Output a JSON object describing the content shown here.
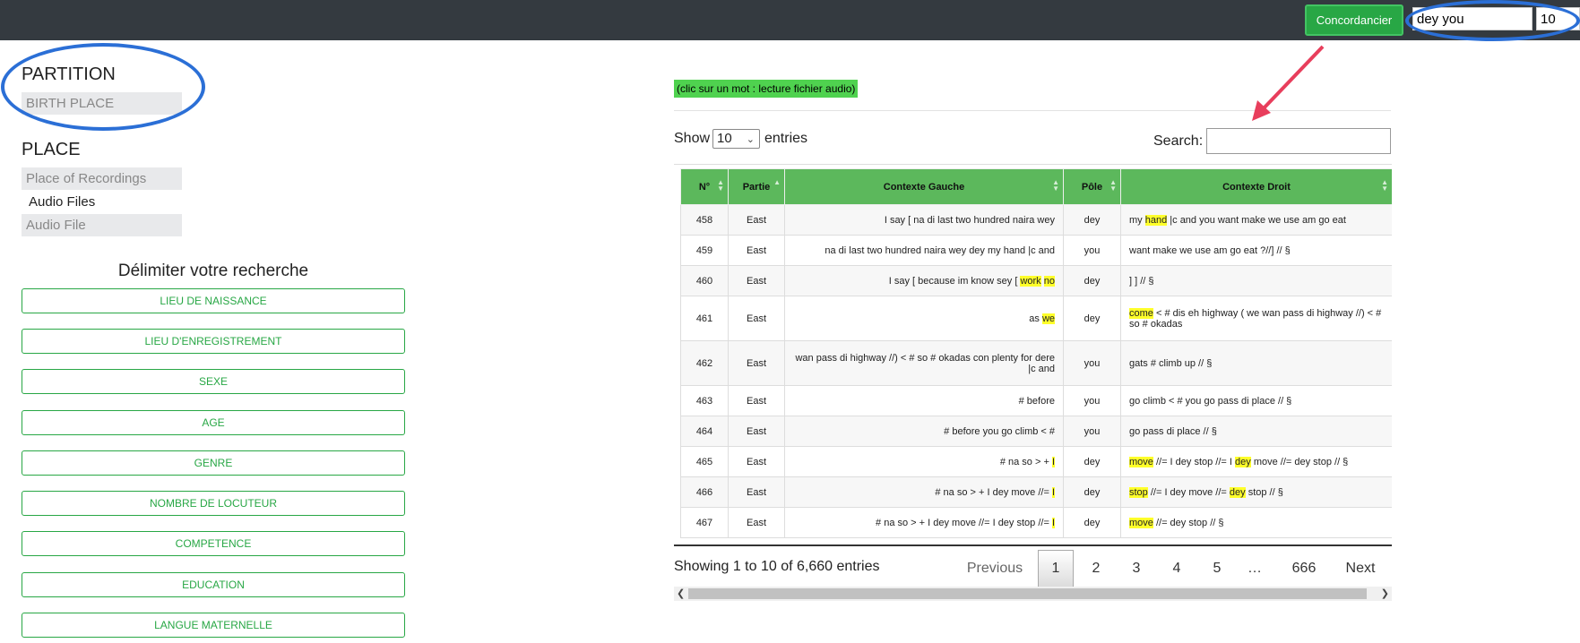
{
  "topbar": {
    "concordancer_label": "Concordancier",
    "query_value": "dey you",
    "limit_value": "10"
  },
  "left": {
    "partition_title": "PARTITION",
    "partition_field": "BIRTH PLACE",
    "place_title": "PLACE",
    "place_field": "Place of Recordings",
    "audio_files_label": "Audio Files",
    "audio_field": "Audio File",
    "delimit_title": "Délimiter votre recherche",
    "filters": [
      "LIEU DE NAISSANCE",
      "LIEU D'ENREGISTREMENT",
      "SEXE",
      "AGE",
      "GENRE",
      "NOMBRE DE LOCUTEUR",
      "COMPETENCE",
      "EDUCATION",
      "LANGUE MATERNELLE"
    ]
  },
  "main": {
    "hint": "(clic sur un mot : lecture fichier audio)",
    "show_label": "Show",
    "entries_value": "10",
    "entries_label": "entries",
    "search_label": "Search:",
    "columns": [
      "N°",
      "Partie",
      "Contexte Gauche",
      "Pôle",
      "Contexte Droit"
    ],
    "rows": [
      {
        "n": "458",
        "part": "East",
        "left": "I say [ na di last two hundred naira wey",
        "pole": "dey",
        "right": "my hand |c and you want make we use am go eat"
      },
      {
        "n": "459",
        "part": "East",
        "left": "na di last two hundred naira wey dey my hand |c and",
        "pole": "you",
        "right": "want make we use am go eat ?//] // §"
      },
      {
        "n": "460",
        "part": "East",
        "left": "I say [ because im know sey [ work no",
        "pole": "dey",
        "right": "] ] // §"
      },
      {
        "n": "461",
        "part": "East",
        "left": "as we",
        "pole": "dey",
        "right": "come < # dis eh highway ( we wan pass di highway //) < # so # okadas"
      },
      {
        "n": "462",
        "part": "East",
        "left": "wan pass di highway //) < # so # okadas con plenty for dere |c and",
        "pole": "you",
        "right": "gats # climb up // §"
      },
      {
        "n": "463",
        "part": "East",
        "left": "# before",
        "pole": "you",
        "right": "go climb < # you go pass di place // §"
      },
      {
        "n": "464",
        "part": "East",
        "left": "# before you go climb < #",
        "pole": "you",
        "right": "go pass di place // §"
      },
      {
        "n": "465",
        "part": "East",
        "left": "# na so > + I",
        "pole": "dey",
        "right": "move //= I dey stop //= I dey move //= dey stop // §"
      },
      {
        "n": "466",
        "part": "East",
        "left": "# na so > + I dey move //= I",
        "pole": "dey",
        "right": "stop //= I dey move //= dey stop // §"
      },
      {
        "n": "467",
        "part": "East",
        "left": "# na so > + I dey move //= I dey stop //= I",
        "pole": "dey",
        "right": "move //= dey stop // §"
      }
    ],
    "showing_text": "Showing 1 to 10 of 6,660 entries",
    "pagination": {
      "previous": "Previous",
      "pages": [
        "1",
        "2",
        "3",
        "4",
        "5",
        "…",
        "666"
      ],
      "next": "Next",
      "current": "1"
    }
  },
  "colors": {
    "topbar": "#343a40",
    "accent_green": "#28a745",
    "header_green": "#5cb85c",
    "highlight": "#ffff2a",
    "annotation_blue": "#2b6fd6",
    "annotation_arrow": "#e83e5c"
  },
  "icons": [
    "sort-icon",
    "chevron-down-icon",
    "arrow-left-icon",
    "arrow-right-icon"
  ]
}
